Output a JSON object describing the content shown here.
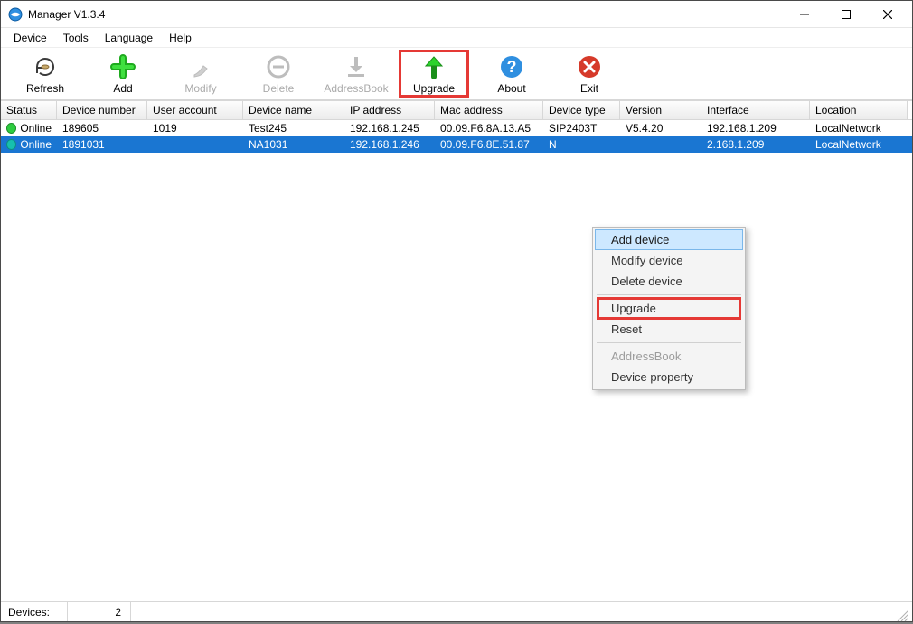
{
  "window": {
    "title": "Manager V1.3.4"
  },
  "menubar": {
    "items": [
      "Device",
      "Tools",
      "Language",
      "Help"
    ]
  },
  "toolbar": {
    "refresh": "Refresh",
    "add": "Add",
    "modify": "Modify",
    "delete": "Delete",
    "addressbook": "AddressBook",
    "upgrade": "Upgrade",
    "about": "About",
    "exit": "Exit"
  },
  "columns": [
    "Status",
    "Device number",
    "User account",
    "Device name",
    "IP address",
    "Mac address",
    "Device type",
    "Version",
    "Interface",
    "Location"
  ],
  "rows": [
    {
      "selected": false,
      "status": "Online",
      "deviceNumber": "189605",
      "userAccount": "1019",
      "deviceName": "Test245",
      "ip": "192.168.1.245",
      "mac": "00.09.F6.8A.13.A5",
      "deviceType": "SIP2403T",
      "version": "V5.4.20",
      "interface": "192.168.1.209",
      "location": "LocalNetwork"
    },
    {
      "selected": true,
      "status": "Online",
      "deviceNumber": "1891031",
      "userAccount": "",
      "deviceName": "NA1031",
      "ip": "192.168.1.246",
      "mac": "00.09.F6.8E.51.87",
      "deviceType": "N",
      "version": "",
      "interface": "2.168.1.209",
      "location": "LocalNetwork"
    }
  ],
  "contextMenu": {
    "addDevice": "Add device",
    "modifyDevice": "Modify device",
    "deleteDevice": "Delete device",
    "upgrade": "Upgrade",
    "reset": "Reset",
    "addressbook": "AddressBook",
    "deviceProperty": "Device property"
  },
  "statusbar": {
    "label": "Devices:",
    "count": "2"
  }
}
